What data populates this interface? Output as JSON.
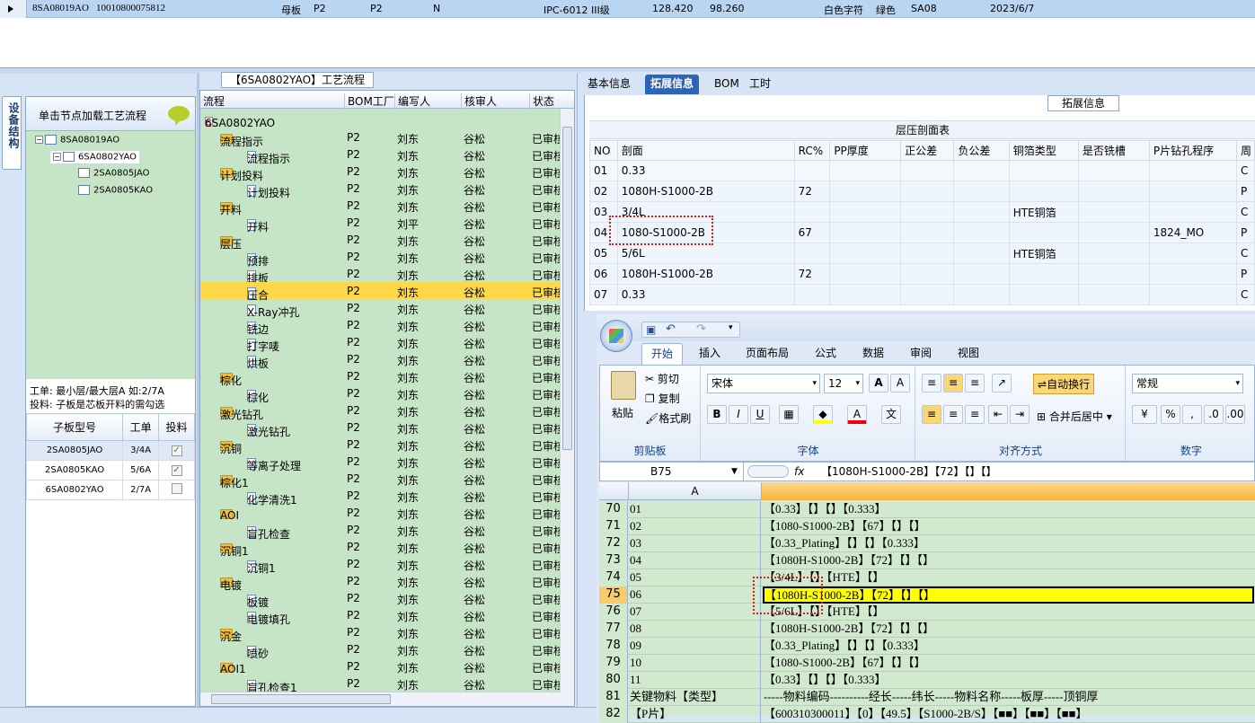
{
  "top_row": {
    "cells": [
      "8SA08019AO",
      "10010800075812",
      "母板",
      "P2",
      "P2",
      "N",
      "IPC-6012 III级",
      "128.420",
      "98.260",
      "白色字符",
      "绿色",
      "SA08",
      "2023/6/7"
    ]
  },
  "left": {
    "vertical_tab": "设备结构",
    "header": "单击节点加载工艺流程",
    "tree": [
      "8SA08019AO",
      "6SA0802YAO",
      "2SA0805JAO",
      "2SA0805KAO"
    ],
    "info_line1": "工单: 最小层/最大层A 如:2/7A",
    "info_line2": "投料: 子板是芯板开料的需勾选",
    "table_headers": [
      "子板型号",
      "工单",
      "投料"
    ],
    "table_rows": [
      {
        "model": "2SA0805JAO",
        "order": "3/4A",
        "check": "✓"
      },
      {
        "model": "2SA0805KAO",
        "order": "5/6A",
        "check": "✓"
      },
      {
        "model": "6SA0802YAO",
        "order": "2/7A",
        "check": ""
      }
    ]
  },
  "middle": {
    "title": "【6SA0802YAO】工艺流程",
    "headers": [
      "流程",
      "BOM工厂",
      "编写人",
      "核审人",
      "状态"
    ],
    "root": "6SA0802YAO",
    "rows": [
      {
        "name": "流程指示",
        "type": "folder",
        "bom": "P2",
        "writer": "刘东",
        "reviewer": "谷松",
        "status": "已审核"
      },
      {
        "name": "流程指示",
        "type": "doc",
        "bom": "P2",
        "writer": "刘东",
        "reviewer": "谷松",
        "status": "已审核"
      },
      {
        "name": "计划投料",
        "type": "folder",
        "bom": "P2",
        "writer": "刘东",
        "reviewer": "谷松",
        "status": "已审核"
      },
      {
        "name": "计划投料",
        "type": "doc",
        "bom": "P2",
        "writer": "刘东",
        "reviewer": "谷松",
        "status": "已审核"
      },
      {
        "name": "开料",
        "type": "folder",
        "bom": "P2",
        "writer": "刘东",
        "reviewer": "谷松",
        "status": "已审核"
      },
      {
        "name": "开料",
        "type": "doc",
        "bom": "P2",
        "writer": "刘平",
        "reviewer": "谷松",
        "status": "已审核"
      },
      {
        "name": "层压",
        "type": "folder",
        "bom": "P2",
        "writer": "刘东",
        "reviewer": "谷松",
        "status": "已审核"
      },
      {
        "name": "预排",
        "type": "doc",
        "bom": "P2",
        "writer": "刘东",
        "reviewer": "谷松",
        "status": "已审核"
      },
      {
        "name": "排板",
        "type": "doc",
        "bom": "P2",
        "writer": "刘东",
        "reviewer": "谷松",
        "status": "已审核"
      },
      {
        "name": "压合",
        "type": "doc",
        "bom": "P2",
        "writer": "刘东",
        "reviewer": "谷松",
        "status": "已审核",
        "selected": true
      },
      {
        "name": "X-Ray冲孔",
        "type": "doc",
        "bom": "P2",
        "writer": "刘东",
        "reviewer": "谷松",
        "status": "已审核"
      },
      {
        "name": "铣边",
        "type": "doc",
        "bom": "P2",
        "writer": "刘东",
        "reviewer": "谷松",
        "status": "已审核"
      },
      {
        "name": "打字唛",
        "type": "doc",
        "bom": "P2",
        "writer": "刘东",
        "reviewer": "谷松",
        "status": "已审核"
      },
      {
        "name": "烘板",
        "type": "doc",
        "bom": "P2",
        "writer": "刘东",
        "reviewer": "谷松",
        "status": "已审核"
      },
      {
        "name": "棕化",
        "type": "folder",
        "bom": "P2",
        "writer": "刘东",
        "reviewer": "谷松",
        "status": "已审核"
      },
      {
        "name": "棕化",
        "type": "doc",
        "bom": "P2",
        "writer": "刘东",
        "reviewer": "谷松",
        "status": "已审核"
      },
      {
        "name": "激光钻孔",
        "type": "folder",
        "bom": "P2",
        "writer": "刘东",
        "reviewer": "谷松",
        "status": "已审核"
      },
      {
        "name": "激光钻孔",
        "type": "doc",
        "bom": "P2",
        "writer": "刘东",
        "reviewer": "谷松",
        "status": "已审核"
      },
      {
        "name": "沉铜",
        "type": "folder",
        "bom": "P2",
        "writer": "刘东",
        "reviewer": "谷松",
        "status": "已审核"
      },
      {
        "name": "等离子处理",
        "type": "doc",
        "bom": "P2",
        "writer": "刘东",
        "reviewer": "谷松",
        "status": "已审核"
      },
      {
        "name": "棕化1",
        "type": "folder",
        "bom": "P2",
        "writer": "刘东",
        "reviewer": "谷松",
        "status": "已审核"
      },
      {
        "name": "化学清洗1",
        "type": "doc",
        "bom": "P2",
        "writer": "刘东",
        "reviewer": "谷松",
        "status": "已审核"
      },
      {
        "name": "AOI",
        "type": "folder",
        "bom": "P2",
        "writer": "刘东",
        "reviewer": "谷松",
        "status": "已审核"
      },
      {
        "name": "盲孔检查",
        "type": "doc",
        "bom": "P2",
        "writer": "刘东",
        "reviewer": "谷松",
        "status": "已审核"
      },
      {
        "name": "沉铜1",
        "type": "folder",
        "bom": "P2",
        "writer": "刘东",
        "reviewer": "谷松",
        "status": "已审核"
      },
      {
        "name": "沉铜1",
        "type": "doc",
        "bom": "P2",
        "writer": "刘东",
        "reviewer": "谷松",
        "status": "已审核"
      },
      {
        "name": "电镀",
        "type": "folder",
        "bom": "P2",
        "writer": "刘东",
        "reviewer": "谷松",
        "status": "已审核"
      },
      {
        "name": "板镀",
        "type": "doc",
        "bom": "P2",
        "writer": "刘东",
        "reviewer": "谷松",
        "status": "已审核"
      },
      {
        "name": "电镀填孔",
        "type": "doc",
        "bom": "P2",
        "writer": "刘东",
        "reviewer": "谷松",
        "status": "已审核"
      },
      {
        "name": "沉金",
        "type": "folder",
        "bom": "P2",
        "writer": "刘东",
        "reviewer": "谷松",
        "status": "已审核"
      },
      {
        "name": "喷砂",
        "type": "doc",
        "bom": "P2",
        "writer": "刘东",
        "reviewer": "谷松",
        "status": "已审核"
      },
      {
        "name": "AOI1",
        "type": "folder",
        "bom": "P2",
        "writer": "刘东",
        "reviewer": "谷松",
        "status": "已审核"
      },
      {
        "name": "盲孔检查1",
        "type": "doc",
        "bom": "P2",
        "writer": "刘东",
        "reviewer": "谷松",
        "status": "已审核"
      }
    ]
  },
  "right": {
    "tabs": [
      "基本信息",
      "拓展信息",
      "BOM",
      "工时"
    ],
    "ext_title": "拓展信息",
    "layer_title": "层压剖面表",
    "headers": [
      "NO",
      "剖面",
      "RC%",
      "PP厚度",
      "正公差",
      "负公差",
      "铜箔类型",
      "是否铣槽",
      "P片钻孔程序",
      "周"
    ],
    "rows": [
      [
        "01",
        "0.33",
        "",
        "",
        "",
        "",
        "",
        "",
        "",
        "C"
      ],
      [
        "02",
        "1080H-S1000-2B",
        "72",
        "",
        "",
        "",
        "",
        "",
        "",
        "P"
      ],
      [
        "03",
        "3/4L",
        "",
        "",
        "",
        "",
        "HTE铜箔",
        "",
        "",
        "C"
      ],
      [
        "04",
        "1080-S1000-2B",
        "67",
        "",
        "",
        "",
        "",
        "",
        "1824_MO",
        "P"
      ],
      [
        "05",
        "5/6L",
        "",
        "",
        "",
        "",
        "HTE铜箔",
        "",
        "",
        "C"
      ],
      [
        "06",
        "1080H-S1000-2B",
        "72",
        "",
        "",
        "",
        "",
        "",
        "",
        "P"
      ],
      [
        "07",
        "0.33",
        "",
        "",
        "",
        "",
        "",
        "",
        "",
        "C"
      ]
    ]
  },
  "excel": {
    "tabs": [
      "开始",
      "插入",
      "页面布局",
      "公式",
      "数据",
      "审阅",
      "视图"
    ],
    "clipboard": {
      "paste": "粘贴",
      "cut": "剪切",
      "copy": "复制",
      "format": "格式刷",
      "label": "剪贴板"
    },
    "font": {
      "name": "宋体",
      "size": "12",
      "label": "字体"
    },
    "align": {
      "wrap": "自动换行",
      "merge": "合并后居中",
      "label": "对齐方式"
    },
    "number": {
      "format": "常规",
      "label": "数字"
    },
    "name_box": "B75",
    "formula": "【1080H-S1000-2B】【72】【】【】",
    "col_a": "A",
    "rows": [
      {
        "n": "70",
        "a": "01",
        "b": "【0.33】【】【】【0.333】"
      },
      {
        "n": "71",
        "a": "02",
        "b": "【1080-S1000-2B】【67】【】【】"
      },
      {
        "n": "72",
        "a": "03",
        "b": "【0.33_Plating】【】【】【0.333】"
      },
      {
        "n": "73",
        "a": "04",
        "b": "【1080H-S1000-2B】【72】【】【】"
      },
      {
        "n": "74",
        "a": "05",
        "b": "【3/4L】【】【HTE】【】"
      },
      {
        "n": "75",
        "a": "06",
        "b": "【1080H-S1000-2B】【72】【】【】",
        "hl": true
      },
      {
        "n": "76",
        "a": "07",
        "b": "【5/6L】【】【HTE】【】"
      },
      {
        "n": "77",
        "a": "08",
        "b": "【1080H-S1000-2B】【72】【】【】"
      },
      {
        "n": "78",
        "a": "09",
        "b": "【0.33_Plating】【】【】【0.333】"
      },
      {
        "n": "79",
        "a": "10",
        "b": "【1080-S1000-2B】【67】【】【】"
      },
      {
        "n": "80",
        "a": "11",
        "b": "【0.33】【】【】【0.333】"
      },
      {
        "n": "81",
        "a": "关键物料【类型】",
        "b": "-----物料编码----------经长-----纬长-----物料名称-----板厚-----顶铜厚"
      },
      {
        "n": "82",
        "a": "【P片】",
        "b": "【600310300011】【0】【49.5】【S1000-2B/S】【■■】【■■】【■■】"
      }
    ]
  }
}
